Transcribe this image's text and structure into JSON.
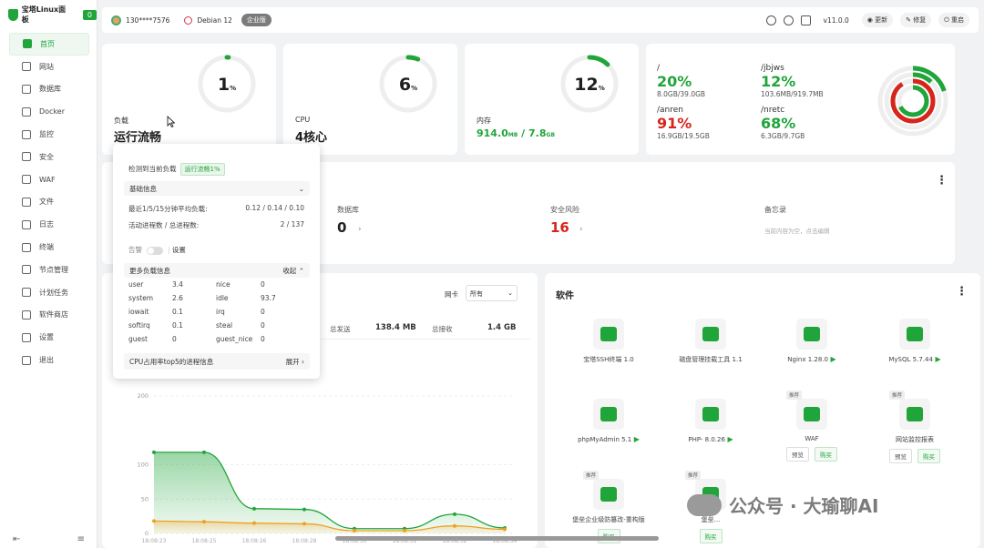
{
  "app": {
    "name": "宝塔Linux面板",
    "badge": "0"
  },
  "sidebar": {
    "items": [
      {
        "label": "首页",
        "icon": "home-icon",
        "active": true
      },
      {
        "label": "网站",
        "icon": "globe-icon"
      },
      {
        "label": "数据库",
        "icon": "database-icon"
      },
      {
        "label": "Docker",
        "icon": "docker-icon"
      },
      {
        "label": "监控",
        "icon": "monitor-icon"
      },
      {
        "label": "安全",
        "icon": "shield-icon"
      },
      {
        "label": "WAF",
        "icon": "waf-icon"
      },
      {
        "label": "文件",
        "icon": "folder-icon"
      },
      {
        "label": "日志",
        "icon": "log-icon"
      },
      {
        "label": "终端",
        "icon": "terminal-icon"
      },
      {
        "label": "节点管理",
        "icon": "nodes-icon"
      },
      {
        "label": "计划任务",
        "icon": "calendar-icon"
      },
      {
        "label": "软件商店",
        "icon": "store-icon"
      },
      {
        "label": "设置",
        "icon": "settings-icon"
      },
      {
        "label": "退出",
        "icon": "logout-icon"
      }
    ]
  },
  "topbar": {
    "user": "130****7576",
    "os": "Debian 12",
    "edition": "企业版",
    "version": "v11.0.0",
    "update": "更新",
    "repair": "修复",
    "restart": "重启"
  },
  "stats": {
    "load": {
      "pct": 1,
      "unit": "%",
      "label": "负载",
      "value": "运行流畅"
    },
    "cpu": {
      "pct": 6,
      "unit": "%",
      "label": "CPU",
      "value": "4核心"
    },
    "mem": {
      "pct": 12,
      "unit": "%",
      "label": "内存",
      "used": "914.0",
      "used_unit": "MB",
      "total": "7.8",
      "total_unit": "GB"
    }
  },
  "disks": [
    {
      "name": "/",
      "pct": "20%",
      "size": "8.0GB/39.0GB",
      "color": "#20a53a"
    },
    {
      "name": "/jbjws",
      "pct": "12%",
      "size": "103.6MB/919.7MB",
      "color": "#20a53a"
    },
    {
      "name": "/anren",
      "pct": "91%",
      "size": "16.9GB/19.5GB",
      "color": "#d6261c"
    },
    {
      "name": "/nretc",
      "pct": "68%",
      "size": "6.3GB/9.7GB",
      "color": "#20a53a"
    }
  ],
  "overview": {
    "db_label": "数据库",
    "db_val": "0",
    "risk_label": "安全风险",
    "risk_val": "16",
    "memo_label": "备忘录",
    "memo_note": "当前内容为空，点击编辑"
  },
  "popup": {
    "detect": "检测到当前负载",
    "status": "运行流畅1%",
    "basic": "基础信息",
    "load_label": "最近1/5/15分钟平均负载:",
    "load_val": "0.12 / 0.14 / 0.10",
    "proc_label": "活动进程数 / 总进程数:",
    "proc_val": "2 / 137",
    "alarm": "告警",
    "setting": "设置",
    "more": "更多负载信息",
    "collapse": "收起",
    "rows": [
      [
        "user",
        "3.4",
        "nice",
        "0"
      ],
      [
        "system",
        "2.6",
        "idle",
        "93.7"
      ],
      [
        "iowait",
        "0.1",
        "irq",
        "0"
      ],
      [
        "softirq",
        "0.1",
        "steal",
        "0"
      ],
      [
        "guest",
        "0",
        "guest_nice",
        "0"
      ]
    ],
    "top5": "CPU占用率top5的进程信息",
    "expand": "展开"
  },
  "traffic": {
    "nic_label": "网卡",
    "nic_value": "所有",
    "sent_label": "总发送",
    "sent": "138.4 MB",
    "recv_label": "总接收",
    "recv": "1.4 GB"
  },
  "chart_data": {
    "type": "area",
    "y_ticks": [
      0,
      50,
      100,
      200
    ],
    "x": [
      "18:08:23",
      "18:08:25",
      "18:08:26",
      "18:08:28",
      "18:08:30",
      "18:08:31",
      "18:08:32",
      "18:08:34"
    ],
    "series": [
      {
        "name": "",
        "values": [
          118,
          118,
          36,
          35,
          7,
          7,
          28,
          8
        ],
        "color": "#20a53a"
      },
      {
        "name": "",
        "values": [
          18,
          17,
          15,
          14,
          4,
          4,
          11,
          6
        ],
        "color": "#f0a020"
      }
    ]
  },
  "software": {
    "title": "软件",
    "items": [
      {
        "name": "宝塔SSH终端 1.0",
        "icon": "terminal-app-icon",
        "play": false,
        "tag": ""
      },
      {
        "name": "磁盘管理挂载工具 1.1",
        "icon": "disk-app-icon",
        "play": false,
        "tag": ""
      },
      {
        "name": "Nginx 1.28.0",
        "icon": "nginx-icon",
        "play": true,
        "tag": ""
      },
      {
        "name": "MySQL 5.7.44",
        "icon": "mysql-icon",
        "play": true,
        "tag": ""
      },
      {
        "name": "phpMyAdmin 5.1",
        "icon": "phpmyadmin-icon",
        "play": true,
        "tag": ""
      },
      {
        "name": "PHP- 8.0.26",
        "icon": "php-icon",
        "play": true,
        "tag": ""
      },
      {
        "name": "WAF",
        "icon": "waf-app-icon",
        "play": false,
        "tag": "推荐",
        "b1": "预览",
        "b2": "购买"
      },
      {
        "name": "网站监控报表",
        "icon": "site-monitor-icon",
        "play": false,
        "tag": "推荐",
        "b1": "预览",
        "b2": "购买"
      },
      {
        "name": "堡垒企业级防篡改-重构版",
        "icon": "tamper-icon",
        "play": false,
        "tag": "推荐",
        "b2": "购买"
      },
      {
        "name": "堡垒...",
        "icon": "tamper2-icon",
        "play": false,
        "tag": "推荐",
        "b2": "购买"
      }
    ]
  },
  "watermark": "公众号 · 大瑜聊AI"
}
